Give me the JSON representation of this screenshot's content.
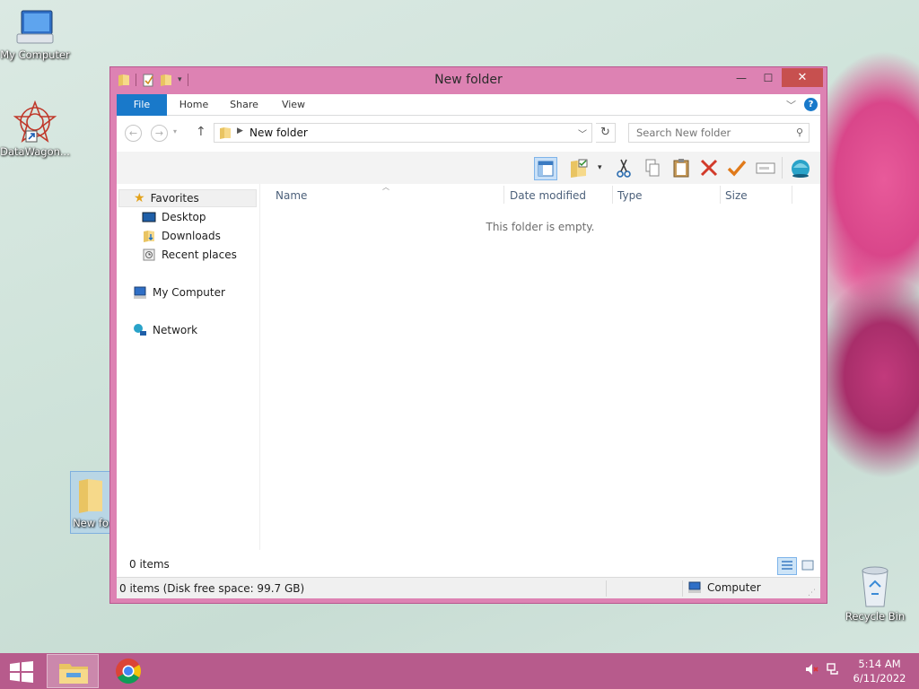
{
  "desktop": {
    "icons": [
      {
        "label": "My Computer"
      },
      {
        "label": "DataWagon..."
      },
      {
        "label": "New fo"
      },
      {
        "label": "Recycle Bin"
      }
    ]
  },
  "window": {
    "title": "New folder",
    "controls": {
      "minimize": "—",
      "maximize": "☐",
      "close": "✕"
    },
    "ribbon": {
      "tabs": [
        {
          "label": "File"
        },
        {
          "label": "Home"
        },
        {
          "label": "Share"
        },
        {
          "label": "View"
        }
      ],
      "help": "?"
    },
    "address": {
      "crumb": "New folder",
      "search_placeholder": "Search New folder"
    },
    "nav": {
      "favorites": "Favorites",
      "desktop": "Desktop",
      "downloads": "Downloads",
      "recent": "Recent places",
      "my_computer": "My Computer",
      "network": "Network"
    },
    "columns": {
      "name": "Name",
      "date": "Date modified",
      "type": "Type",
      "size": "Size"
    },
    "empty_message": "This folder is empty.",
    "item_count": "0 items",
    "status": {
      "left": "0 items (Disk free space: 99.7 GB)",
      "right": "Computer"
    }
  },
  "taskbar": {
    "time": "5:14 AM",
    "date": "6/11/2022"
  },
  "colors": {
    "window_frame": "#dd82b3",
    "accent": "#1979ca",
    "taskbar": "#b75b8c",
    "close_button": "#c7504f"
  }
}
